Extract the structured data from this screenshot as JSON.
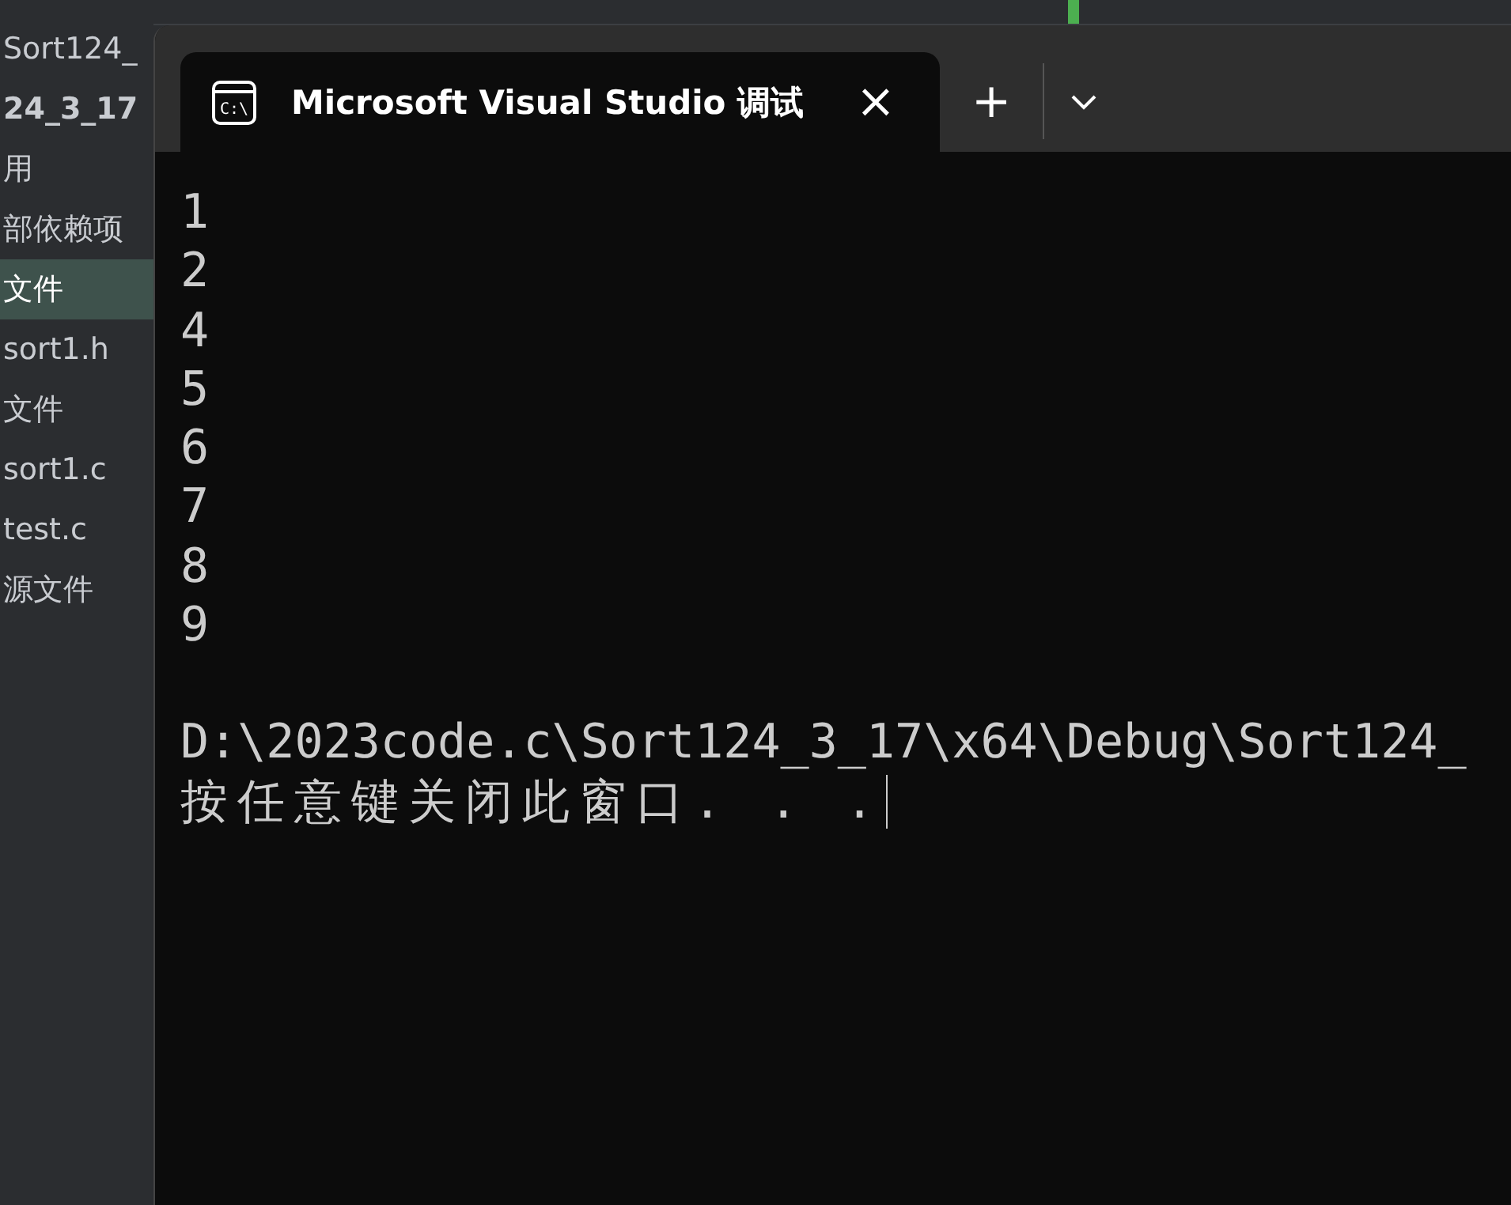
{
  "sidebar": {
    "items": [
      {
        "label": "Sort124_",
        "kind": "item",
        "selected": false
      },
      {
        "label": "24_3_17",
        "kind": "project",
        "selected": false
      },
      {
        "label": "用",
        "kind": "item",
        "selected": false
      },
      {
        "label": "部依赖项",
        "kind": "item",
        "selected": false
      },
      {
        "label": "文件",
        "kind": "item",
        "selected": true
      },
      {
        "label": "sort1.h",
        "kind": "item",
        "selected": false
      },
      {
        "label": "文件",
        "kind": "item",
        "selected": false
      },
      {
        "label": "sort1.c",
        "kind": "item",
        "selected": false
      },
      {
        "label": "test.c",
        "kind": "item",
        "selected": false
      },
      {
        "label": "源文件",
        "kind": "item",
        "selected": false
      }
    ]
  },
  "terminal": {
    "tabs": [
      {
        "icon_label": "C:\\",
        "title": "Microsoft Visual Studio 调试",
        "selected": true,
        "close": "×"
      }
    ],
    "new_tab": "+",
    "output_lines": [
      "1",
      "2",
      "4",
      "5",
      "6",
      "7",
      "8",
      "9"
    ],
    "path_line": "D:\\2023code.c\\Sort124_3_17\\x64\\Debug\\Sort124_",
    "prompt": "按任意键关闭此窗口. . ."
  }
}
